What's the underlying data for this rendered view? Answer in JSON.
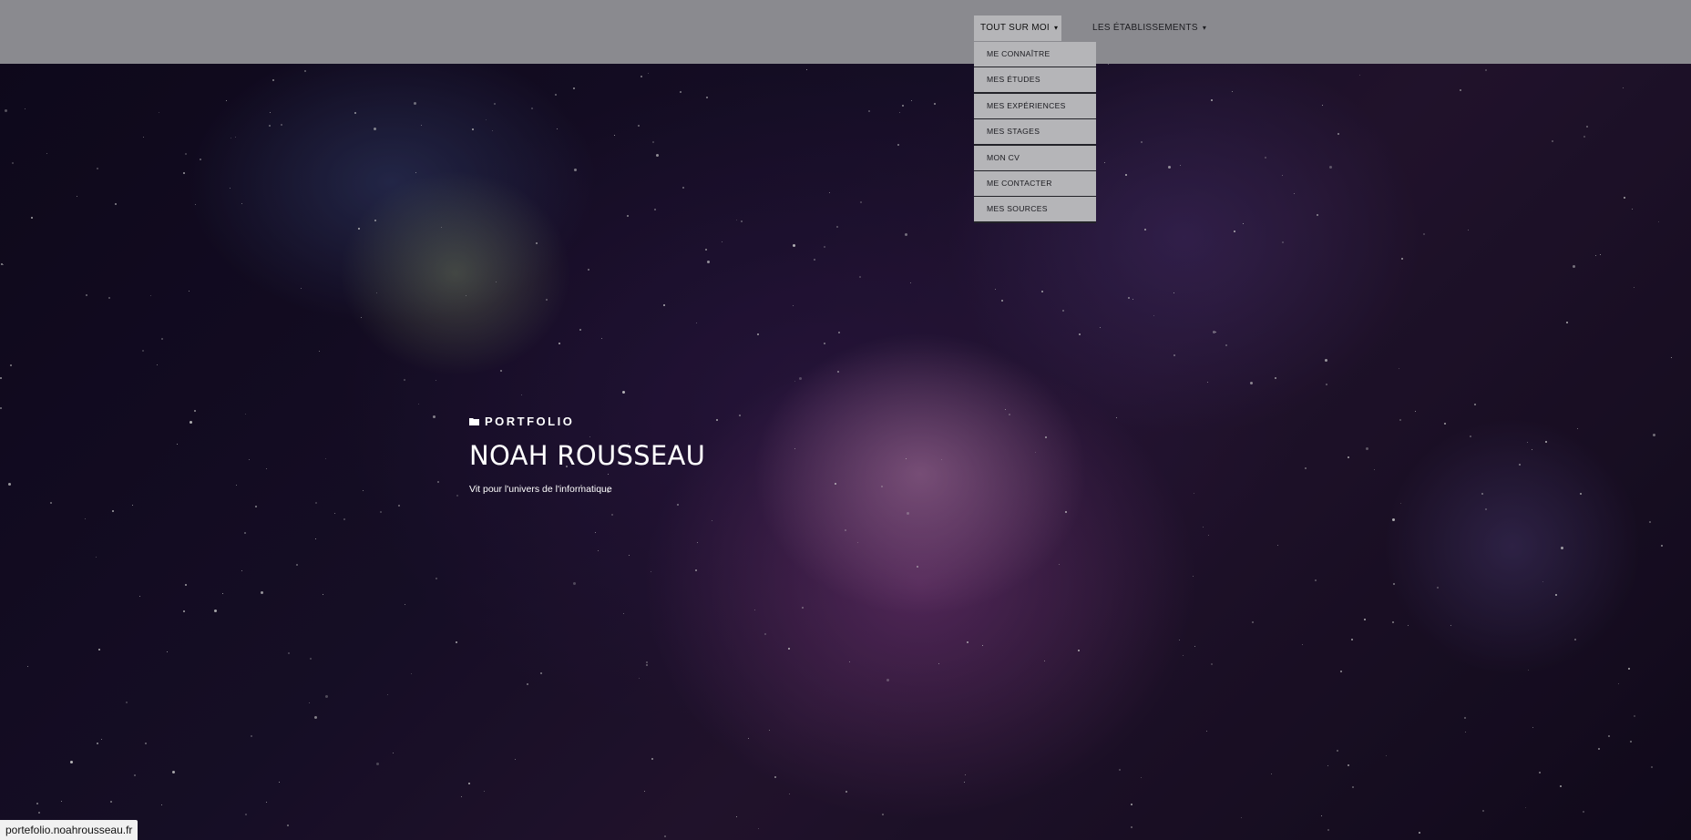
{
  "nav": {
    "items": [
      {
        "label": "TOUT SUR MOI",
        "icon": "chevron-down-icon",
        "active": true
      },
      {
        "label": "LES ÉTABLISSEMENTS",
        "icon": "chevron-down-icon",
        "active": false
      }
    ],
    "dropdown": [
      {
        "label": "ME CONNAÎTRE"
      },
      {
        "label": "MES ÉTUDES"
      },
      {
        "label": "MES EXPÉRIENCES"
      },
      {
        "label": "MES STAGES"
      },
      {
        "label": "MON CV"
      },
      {
        "label": "ME CONTACTER"
      },
      {
        "label": "MES SOURCES"
      }
    ]
  },
  "hero": {
    "icon": "folder-icon",
    "eyebrow": "PORTFOLIO",
    "title": "NOAH ROUSSEAU",
    "tagline": "Vit pour l'univers de l'informatique"
  },
  "statusbar": {
    "url": "portefolio.noahrousseau.fr"
  },
  "colors": {
    "topbar": "#8a8a8f",
    "menu_item": "#b5b5b8",
    "text_light": "#ffffff"
  }
}
